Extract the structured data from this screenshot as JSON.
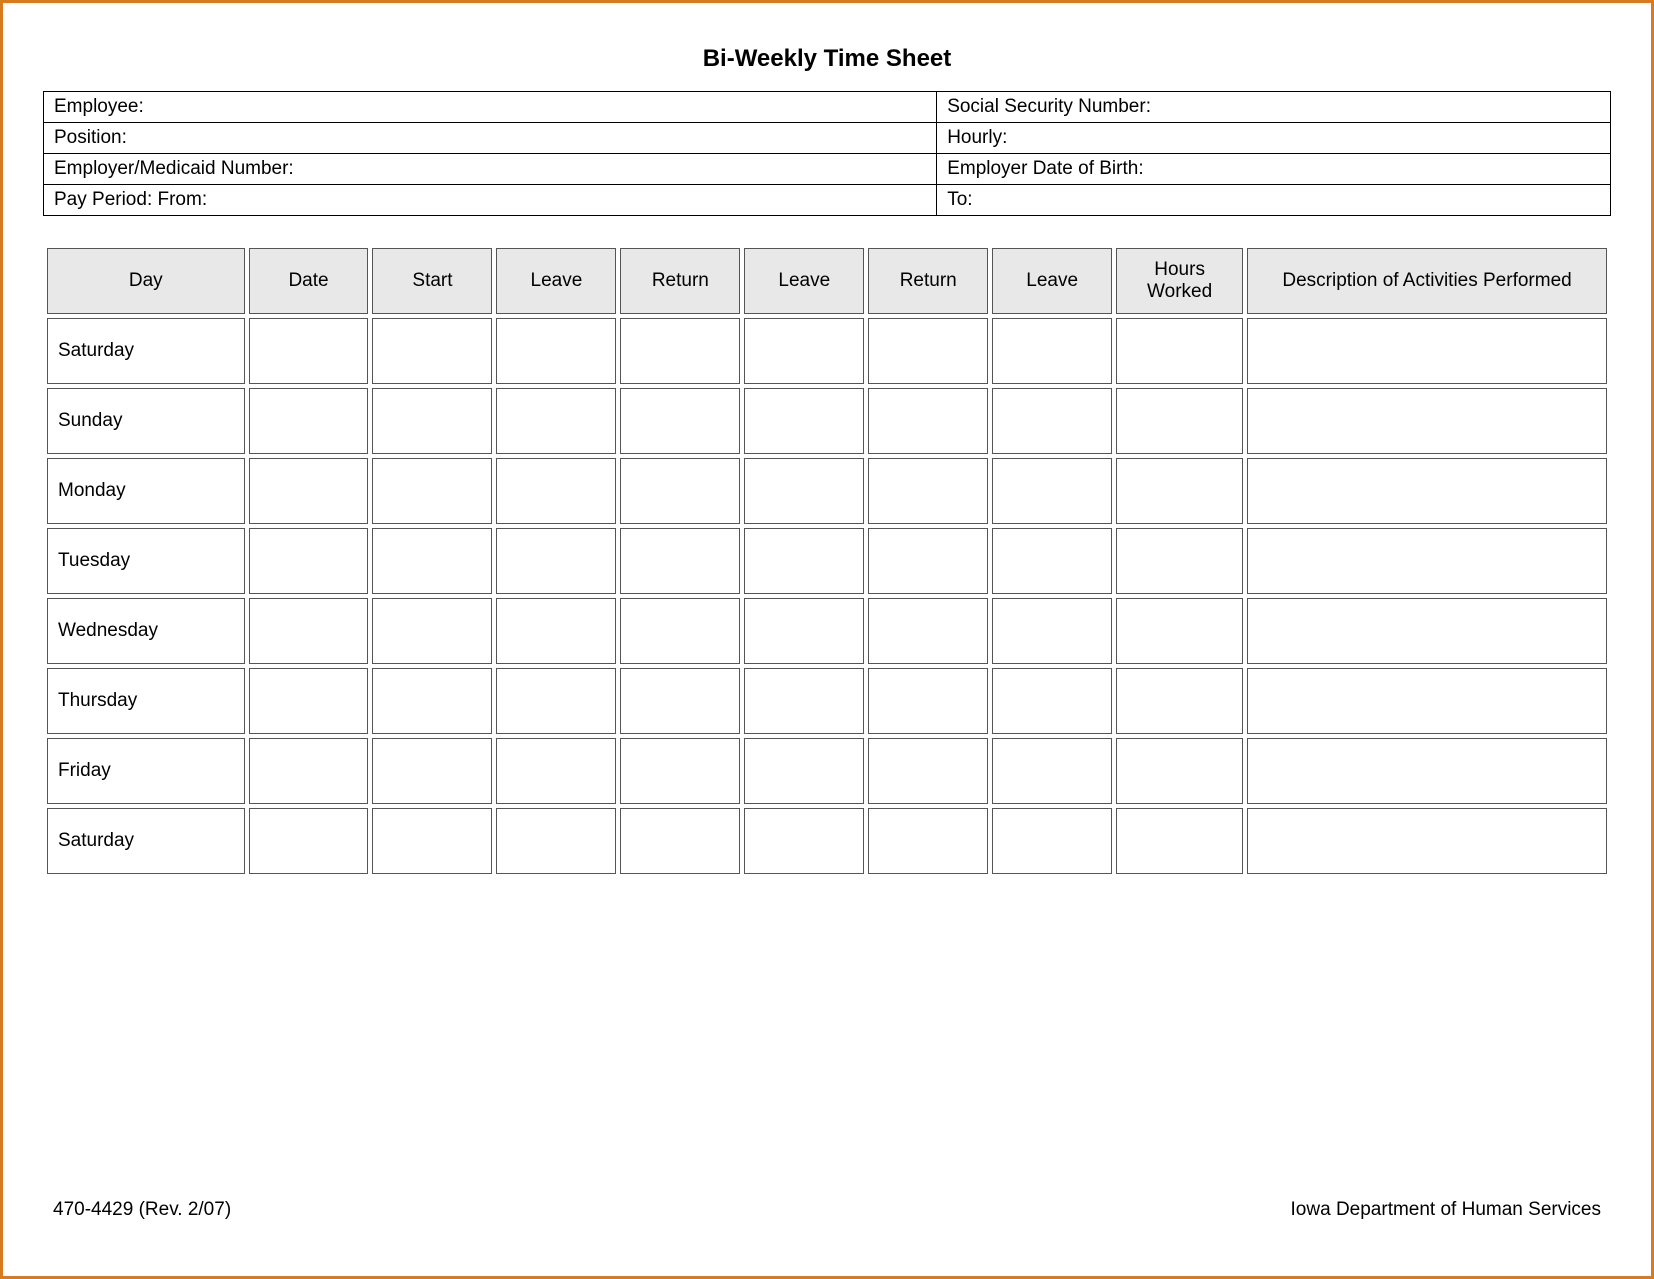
{
  "title": "Bi-Weekly Time Sheet",
  "info": {
    "employee": "Employee:",
    "ssn": "Social Security Number:",
    "position": "Position:",
    "hourly": "Hourly:",
    "employer_medicaid": "Employer/Medicaid Number:",
    "employer_dob": "Employer Date of Birth:",
    "pay_period_from": "Pay Period:  From:",
    "to": "To:"
  },
  "columns": {
    "day": "Day",
    "date": "Date",
    "start": "Start",
    "leave1": "Leave",
    "return1": "Return",
    "leave2": "Leave",
    "return2": "Return",
    "leave3": "Leave",
    "hours_worked": "Hours Worked",
    "description": "Description of Activities Performed"
  },
  "rows": [
    {
      "day": "Saturday"
    },
    {
      "day": "Sunday"
    },
    {
      "day": "Monday"
    },
    {
      "day": "Tuesday"
    },
    {
      "day": "Wednesday"
    },
    {
      "day": "Thursday"
    },
    {
      "day": "Friday"
    },
    {
      "day": "Saturday"
    }
  ],
  "footer": {
    "form_number": "470-4429  (Rev. 2/07)",
    "department": "Iowa Department of Human Services"
  }
}
